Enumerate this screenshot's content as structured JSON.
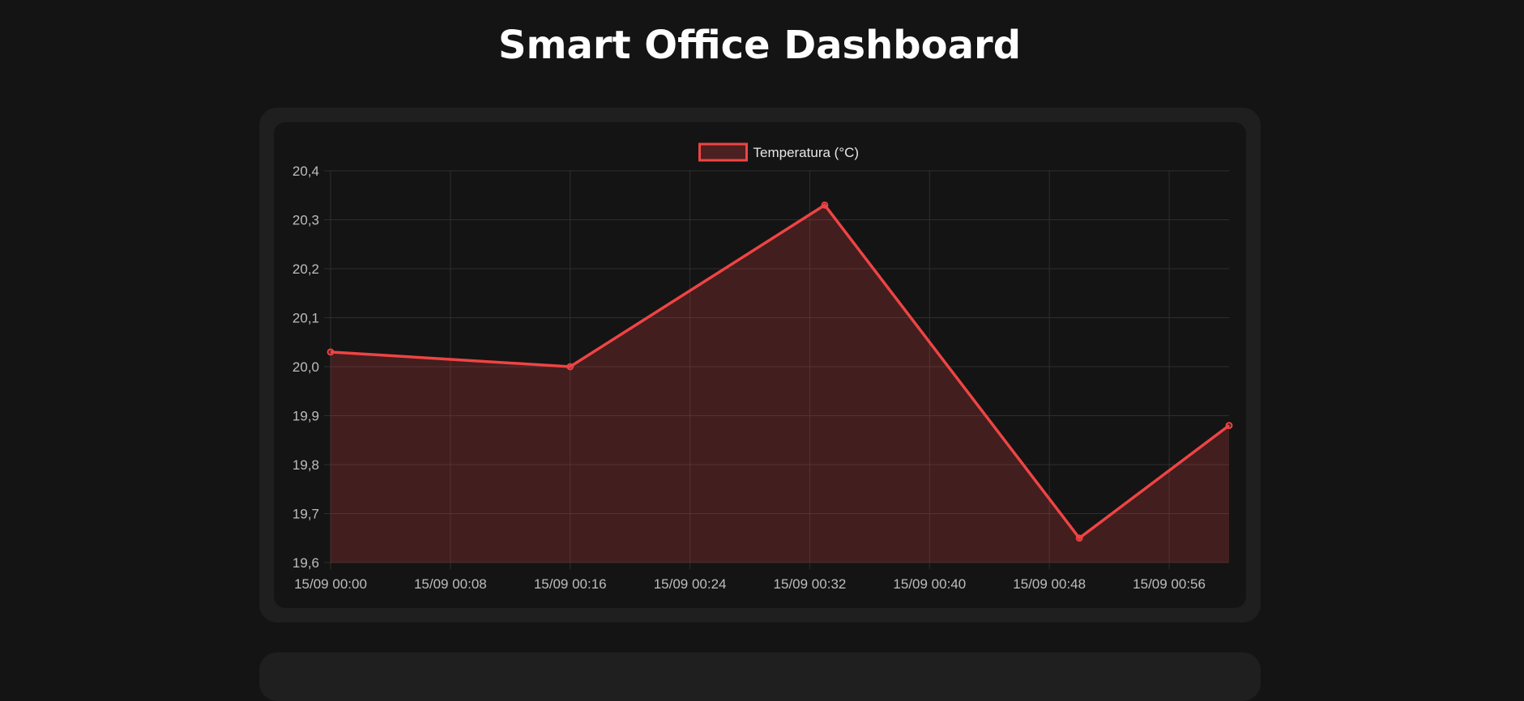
{
  "page": {
    "title": "Smart Office Dashboard"
  },
  "colors": {
    "background": "#141414",
    "card": "#1f1f1f",
    "line": "#ef4444",
    "fill": "rgba(239,68,68,0.22)",
    "grid": "#2e2e2e",
    "tick": "#bdbdbd"
  },
  "chart_data": {
    "type": "line",
    "legend": {
      "position": "top-center",
      "items": [
        "Temperatura (°C)"
      ]
    },
    "series": [
      {
        "name": "Temperatura (°C)",
        "color": "#ef4444",
        "fill": true,
        "points": [
          {
            "x": "15/09 00:00",
            "y": 20.03
          },
          {
            "x": "15/09 00:16",
            "y": 20.0
          },
          {
            "x": "15/09 00:33",
            "y": 20.33
          },
          {
            "x": "15/09 00:50",
            "y": 19.65
          },
          {
            "x": "15/09 01:00",
            "y": 19.88
          }
        ]
      }
    ],
    "x_ticks": [
      "15/09 00:00",
      "15/09 00:08",
      "15/09 00:16",
      "15/09 00:24",
      "15/09 00:32",
      "15/09 00:40",
      "15/09 00:48",
      "15/09 00:56"
    ],
    "y_ticks": [
      "20,4",
      "20,3",
      "20,2",
      "20,1",
      "20,0",
      "19,9",
      "19,8",
      "19,7",
      "19,6"
    ],
    "xlim": [
      "15/09 00:00",
      "15/09 01:00"
    ],
    "ylim": [
      19.6,
      20.4
    ],
    "grid": true
  }
}
